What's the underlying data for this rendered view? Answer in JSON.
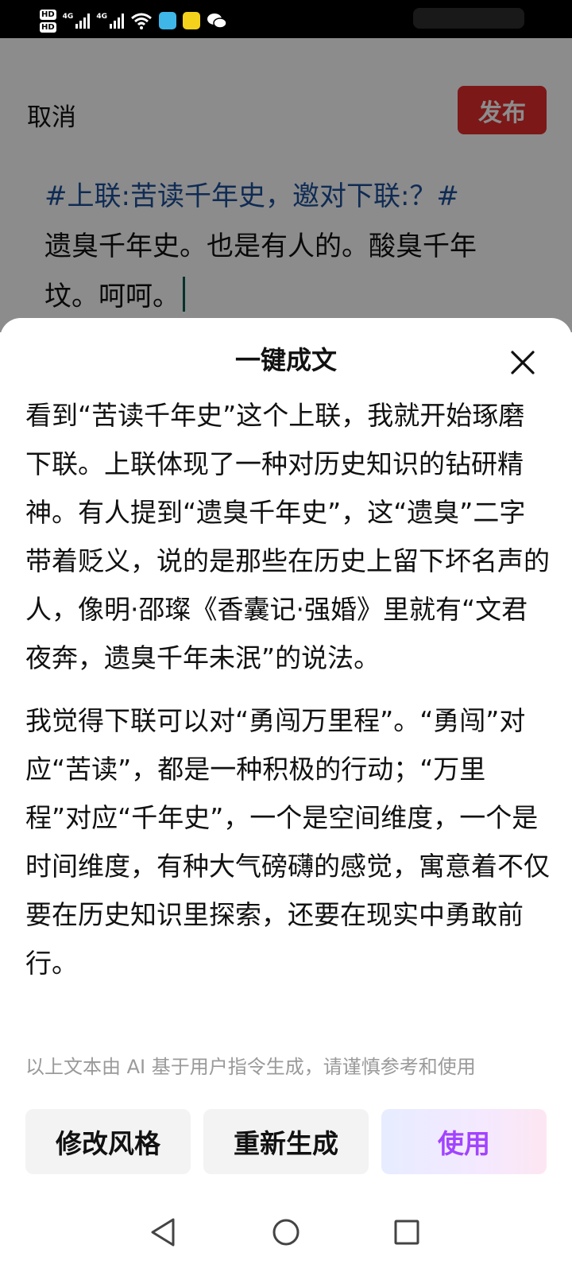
{
  "status_bar": {
    "hd1": "HD",
    "hd2": "HD",
    "net1": "4G",
    "net2": "4G"
  },
  "editor": {
    "cancel_label": "取消",
    "publish_label": "发布",
    "topic": "#上联:苦读千年史，邀对下联:？#",
    "body": "遗臭千年史。也是有人的。酸臭千年坟。呵呵。"
  },
  "sheet": {
    "title": "一键成文",
    "paragraphs": [
      "看到“苦读千年史”这个上联，我就开始琢磨下联。上联体现了一种对历史知识的钻研精神。有人提到“遗臭千年史”，这“遗臭”二字带着贬义，说的是那些在历史上留下坏名声的人，像明·邵璨《香囊记·强婚》里就有“文君夜奔，遗臭千年未泯”的说法。",
      "我觉得下联可以对“勇闯万里程”。“勇闯”对应“苦读”，都是一种积极的行动；“万里程”对应“千年史”，一个是空间维度，一个是时间维度，有种大气磅礴的感觉，寓意着不仅要在历史知识里探索，还要在现实中勇敢前行。"
    ],
    "disclaimer": "以上文本由 AI 基于用户指令生成，请谨慎参考和使用",
    "actions": {
      "modify_style": "修改风格",
      "regenerate": "重新生成",
      "use": "使用"
    }
  },
  "colors": {
    "publish": "#e22c2c",
    "topic": "#1d4f99",
    "use_text": "#a243ff"
  },
  "icons": {
    "close": "close-icon",
    "nav_back": "back-triangle-icon",
    "nav_home": "home-circle-icon",
    "nav_recents": "recents-square-icon"
  }
}
